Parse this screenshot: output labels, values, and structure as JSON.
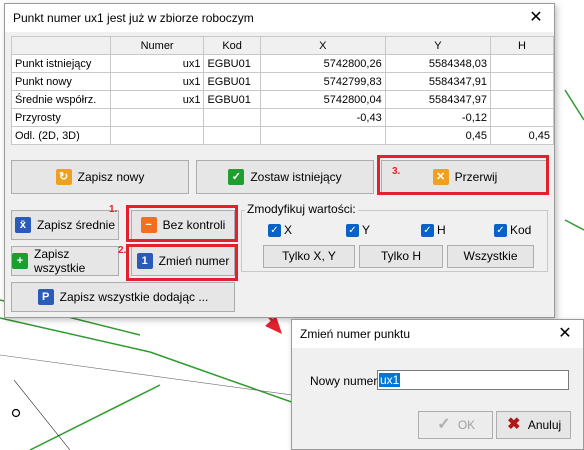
{
  "main_dialog": {
    "title": "Punkt numer ux1 jest już w zbiorze roboczym",
    "close_glyph": "✕",
    "table": {
      "headers": [
        "",
        "Numer",
        "Kod",
        "X",
        "Y",
        "H"
      ],
      "rows": [
        [
          "Punkt istniejący",
          "ux1",
          "EGBU01",
          "5742800,26",
          "5584348,03",
          ""
        ],
        [
          "Punkt nowy",
          "ux1",
          "EGBU01",
          "5742799,83",
          "5584347,91",
          ""
        ],
        [
          "Średnie współrz.",
          "ux1",
          "EGBU01",
          "5742800,04",
          "5584347,97",
          ""
        ],
        [
          "Przyrosty",
          "",
          "",
          "-0,43",
          "-0,12",
          ""
        ],
        [
          "Odl. (2D, 3D)",
          "",
          "",
          "",
          "0,45",
          "0,45"
        ]
      ]
    },
    "buttons": {
      "zapisz_nowy": "Zapisz nowy",
      "zostaw_istniejacy": "Zostaw istniejący",
      "przerwij": "Przerwij",
      "zapisz_srednie": "Zapisz średnie",
      "bez_kontroli": "Bez kontroli",
      "zapisz_wszystkie": "Zapisz wszystkie",
      "zmien_numer": "Zmień numer",
      "zapisz_wszystkie_dodajac": "Zapisz wszystkie dodając ..."
    },
    "modify_group": {
      "label": "Zmodyfikuj wartości:",
      "checkboxes": [
        {
          "label": "X",
          "checked": true
        },
        {
          "label": "Y",
          "checked": true
        },
        {
          "label": "H",
          "checked": true
        },
        {
          "label": "Kod",
          "checked": true
        }
      ],
      "buttons": [
        "Tylko X, Y",
        "Tylko H",
        "Wszystkie"
      ]
    }
  },
  "annotations": {
    "step1": "1.",
    "step2": "2.",
    "step3": "3.",
    "box_color": "#e4202d"
  },
  "rename_dialog": {
    "title": "Zmień numer punktu",
    "close_glyph": "✕",
    "field_label": "Nowy numer:",
    "field_value": "ux1",
    "ok_label": "OK",
    "ok_enabled": false,
    "cancel_label": "Anuluj"
  },
  "colors": {
    "accent": "#0078d7",
    "checkbox": "#0a62c4",
    "background_lines": "#2e9a2e"
  }
}
